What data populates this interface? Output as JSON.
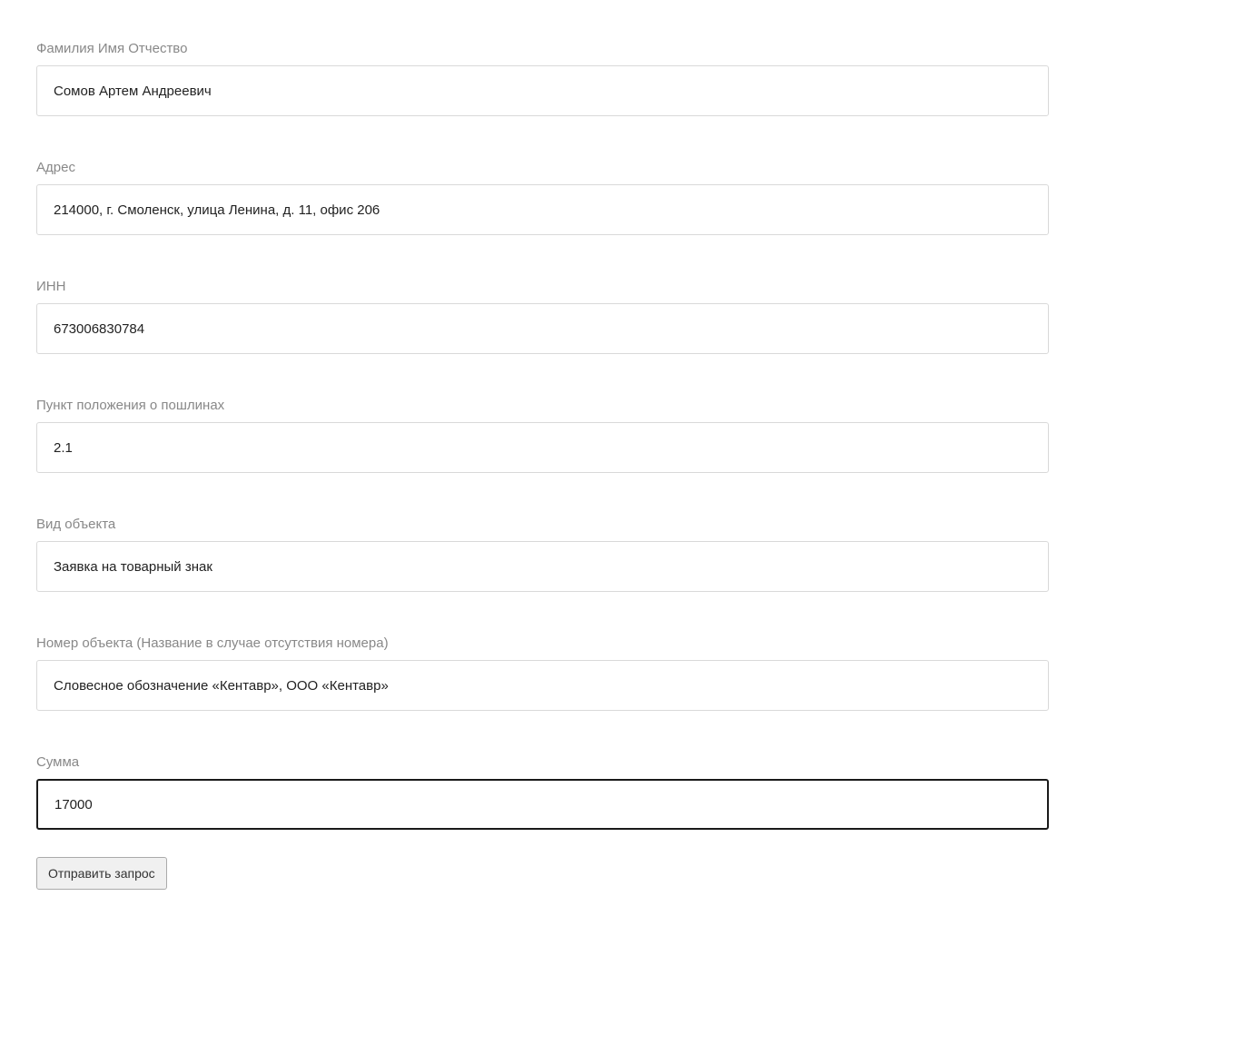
{
  "form": {
    "full_name": {
      "label": "Фамилия Имя Отчество",
      "value": "Сомов Артем Андреевич"
    },
    "address": {
      "label": "Адрес",
      "value": "214000, г. Смоленск, улица Ленина, д. 11, офис 206"
    },
    "inn": {
      "label": "ИНН",
      "value": "673006830784"
    },
    "fee_regulation_item": {
      "label": "Пункт положения о пошлинах",
      "value": "2.1"
    },
    "object_type": {
      "label": "Вид объекта",
      "value": "Заявка на товарный знак"
    },
    "object_number": {
      "label": "Номер объекта (Название в случае отсутствия номера)",
      "value": "Словесное обозначение «Кентавр», ООО «Кентавр»"
    },
    "sum": {
      "label": "Сумма",
      "value": "17000"
    },
    "submit_label": "Отправить запрос"
  }
}
